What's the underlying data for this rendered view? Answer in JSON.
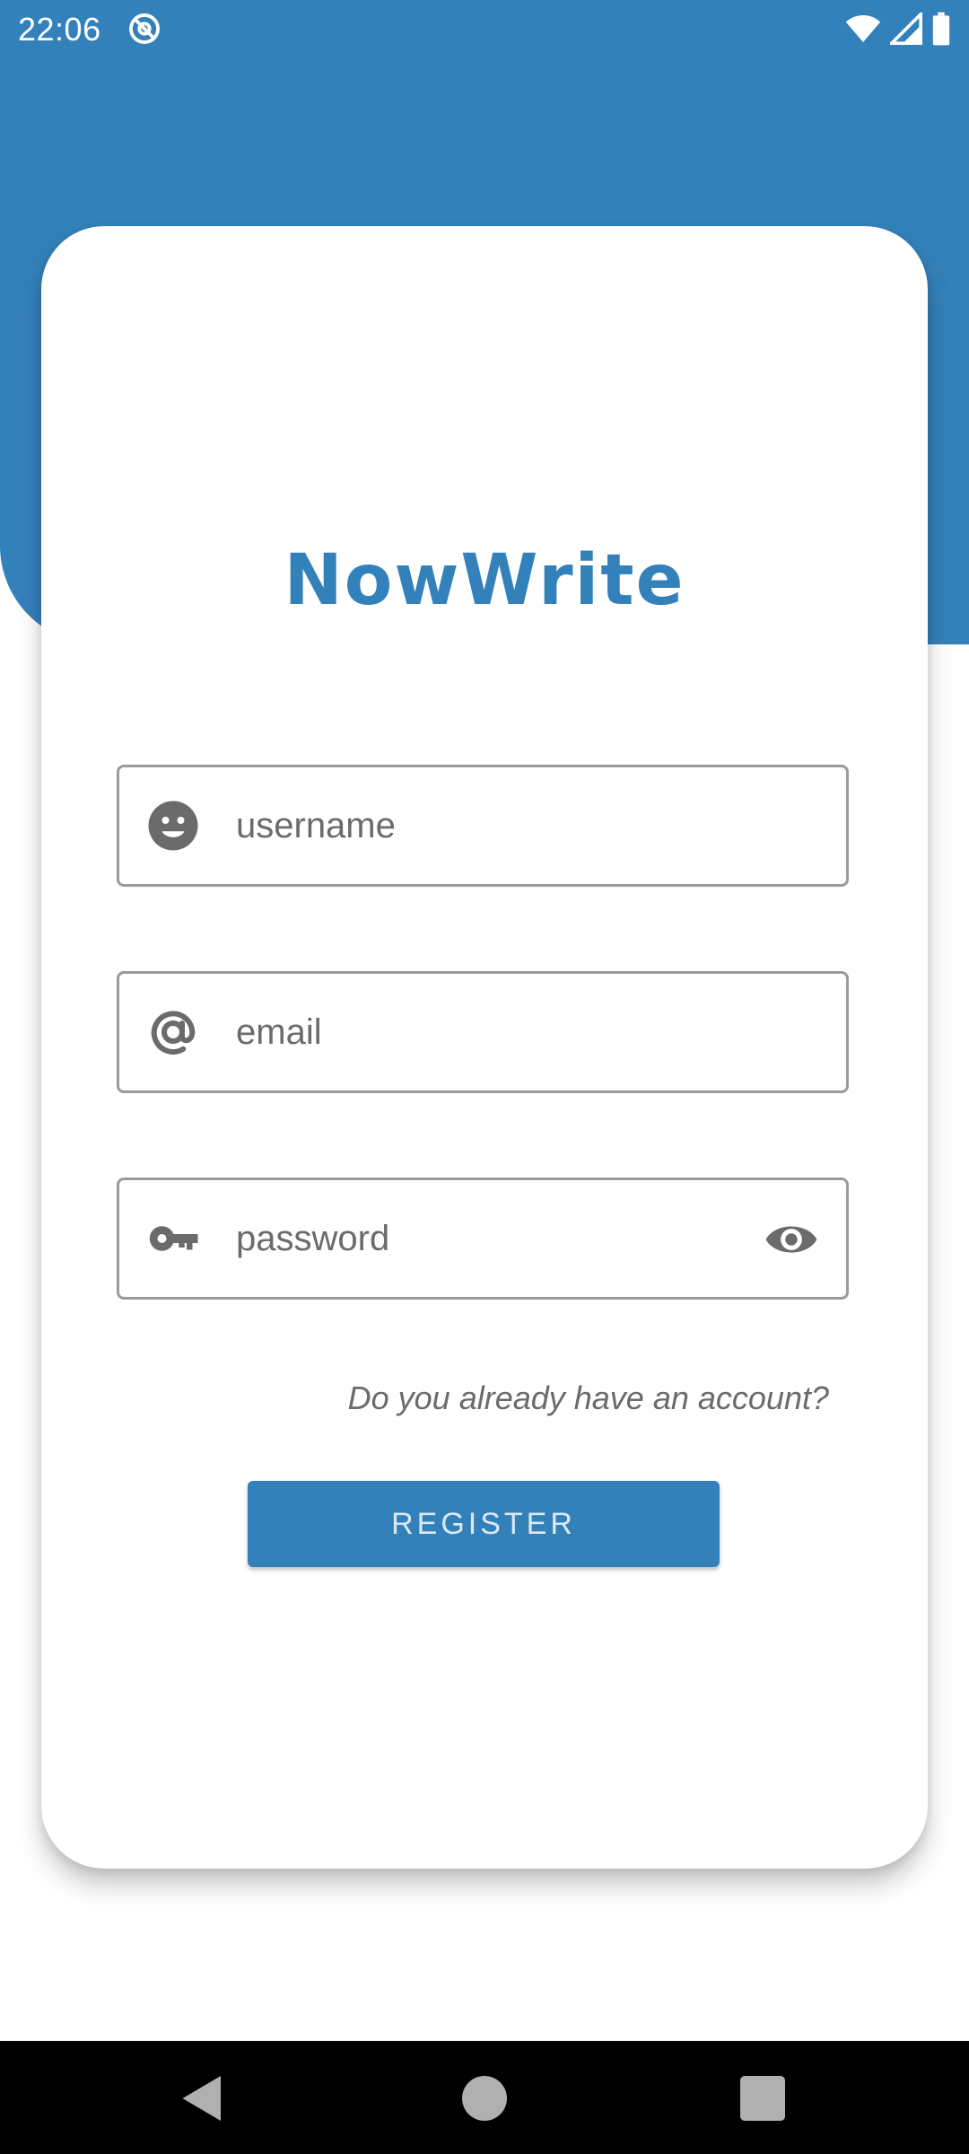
{
  "status_bar": {
    "time": "22:06",
    "notification_icon": "at-sign-icon",
    "wifi_icon": "wifi-icon",
    "signal_icon": "signal-icon",
    "battery_icon": "battery-icon"
  },
  "app": {
    "logo_text": "NowWrite",
    "brand_color": "#3381ba"
  },
  "form": {
    "username": {
      "placeholder": "username",
      "icon": "face-icon"
    },
    "email": {
      "placeholder": "email",
      "icon": "at-icon"
    },
    "password": {
      "placeholder": "password",
      "icon": "key-icon",
      "toggle_icon": "eye-icon"
    },
    "account_link": "Do you already have an account?",
    "register_label": "REGISTER"
  },
  "nav_bar": {
    "back_icon": "back-triangle-icon",
    "home_icon": "home-circle-icon",
    "recents_icon": "recents-square-icon"
  }
}
